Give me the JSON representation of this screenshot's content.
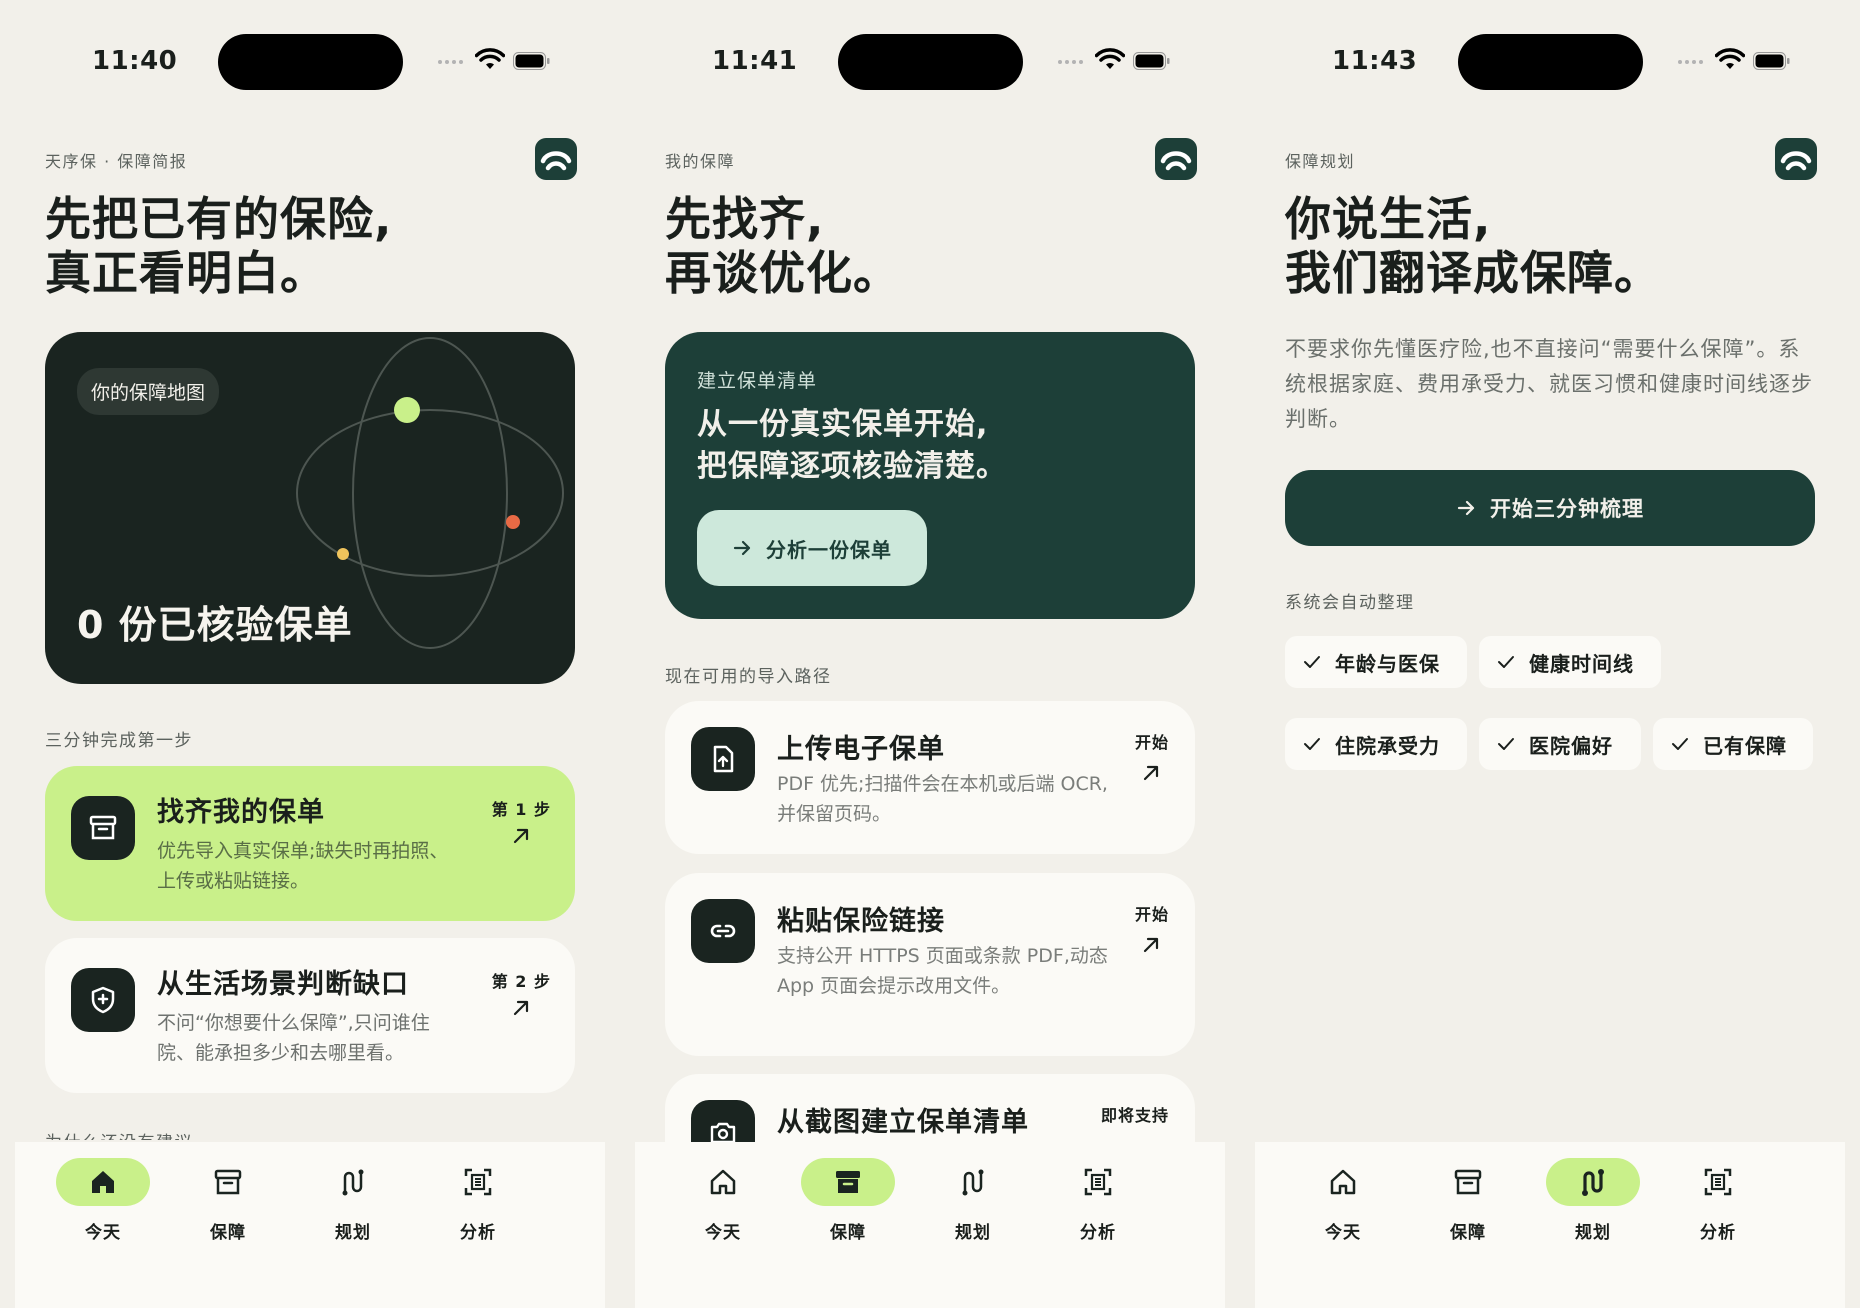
{
  "colors": {
    "bg": "#f2f0ea",
    "dark": "#1a2420",
    "forest": "#1d3f38",
    "lime": "#c9f08a",
    "card": "#fbfaf6",
    "mint": "#cde8db"
  },
  "tabs": [
    {
      "label": "今天",
      "icon": "home-icon"
    },
    {
      "label": "保障",
      "icon": "archive-icon"
    },
    {
      "label": "规划",
      "icon": "route-icon"
    },
    {
      "label": "分析",
      "icon": "scan-icon"
    }
  ],
  "screen1": {
    "time": "11:40",
    "kicker": "天序保 · 保障简报",
    "title_line1": "先把已有的保险,",
    "title_line2": "真正看明白。",
    "map": {
      "badge": "你的保障地图",
      "count_text": "0 份已核验保单"
    },
    "section": "三分钟完成第一步",
    "steps": [
      {
        "title": "找齐我的保单",
        "desc": "优先导入真实保单;缺失时再拍照、上传或粘贴链接。",
        "badge": "第 1 步"
      },
      {
        "title": "从生活场景判断缺口",
        "desc": "不问“你想要什么保障”,只问谁住院、能承担多少和去哪里看。",
        "badge": "第 2 步"
      }
    ],
    "faded_section": "为什么还没有建议"
  },
  "screen2": {
    "time": "11:41",
    "kicker": "我的保障",
    "title_line1": "先找齐,",
    "title_line2": "再谈优化。",
    "card": {
      "kicker": "建立保单清单",
      "title_line1": "从一份真实保单开始,",
      "title_line2": "把保障逐项核验清楚。",
      "button": "分析一份保单"
    },
    "section": "现在可用的导入路径",
    "imports": [
      {
        "title": "上传电子保单",
        "desc": "PDF 优先;扫描件会在本机或后端 OCR,并保留页码。",
        "badge": "开始"
      },
      {
        "title": "粘贴保险链接",
        "desc": "支持公开 HTTPS 页面或条款 PDF,动态 App 页面会提示改用文件。",
        "badge": "开始"
      },
      {
        "title": "从截图建立保单清单",
        "desc": "",
        "badge": "即将支持"
      }
    ]
  },
  "screen3": {
    "time": "11:43",
    "kicker": "保障规划",
    "title_line1": "你说生活,",
    "title_line2": "我们翻译成保障。",
    "desc": "不要求你先懂医疗险,也不直接问“需要什么保障”。系统根据家庭、费用承受力、就医习惯和健康时间线逐步判断。",
    "cta": "开始三分钟梳理",
    "section": "系统会自动整理",
    "chips": [
      "年龄与医保",
      "健康时间线",
      "住院承受力",
      "医院偏好",
      "已有保障"
    ]
  }
}
